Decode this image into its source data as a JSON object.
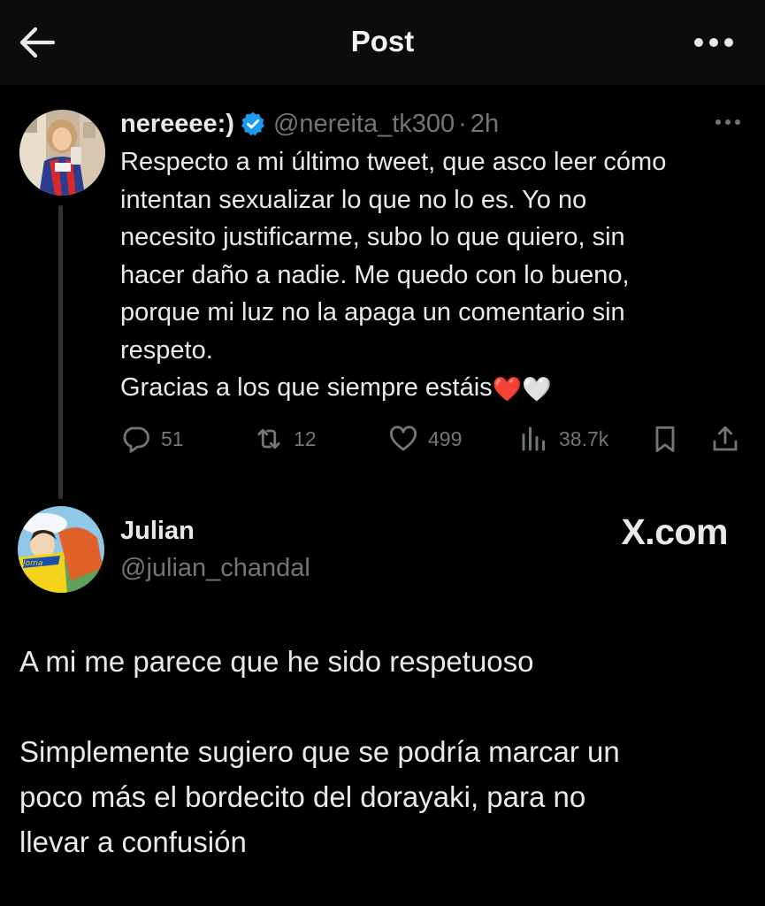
{
  "header": {
    "title": "Post",
    "back_icon": "arrow-left-icon",
    "more_icon": "more-horizontal-icon"
  },
  "tweet": {
    "display_name": "nereeee:)",
    "verified": true,
    "handle": "@nereita_tk300",
    "separator": "·",
    "time": "2h",
    "text_lines": [
      "Respecto a mi último tweet, que asco leer cómo",
      "intentan sexualizar lo que no lo es. Yo no",
      "necesito justificarme, subo lo que quiero, sin",
      "hacer daño a nadie. Me quedo con lo bueno,",
      "porque mi luz no la apaga un comentario sin",
      "respeto."
    ],
    "last_line": "Gracias a los que siempre estáis",
    "emojis": "❤️🤍",
    "stats": {
      "replies": "51",
      "reposts": "12",
      "likes": "499",
      "views": "38.7k"
    }
  },
  "reply": {
    "display_name": "Julian",
    "handle": "@julian_chandal",
    "watermark": "X.com",
    "paragraph1": "A mi me parece que he sido respetuoso",
    "paragraph2_lines": [
      "Simplemente sugiero que se podría marcar un",
      "poco más el bordecito del dorayaki, para no",
      "llevar a confusión"
    ]
  },
  "colors": {
    "background": "#000000",
    "topbar": "#0c0c0c",
    "text": "#e7e9ea",
    "muted": "#71767b",
    "verified": "#1d9bf0"
  }
}
